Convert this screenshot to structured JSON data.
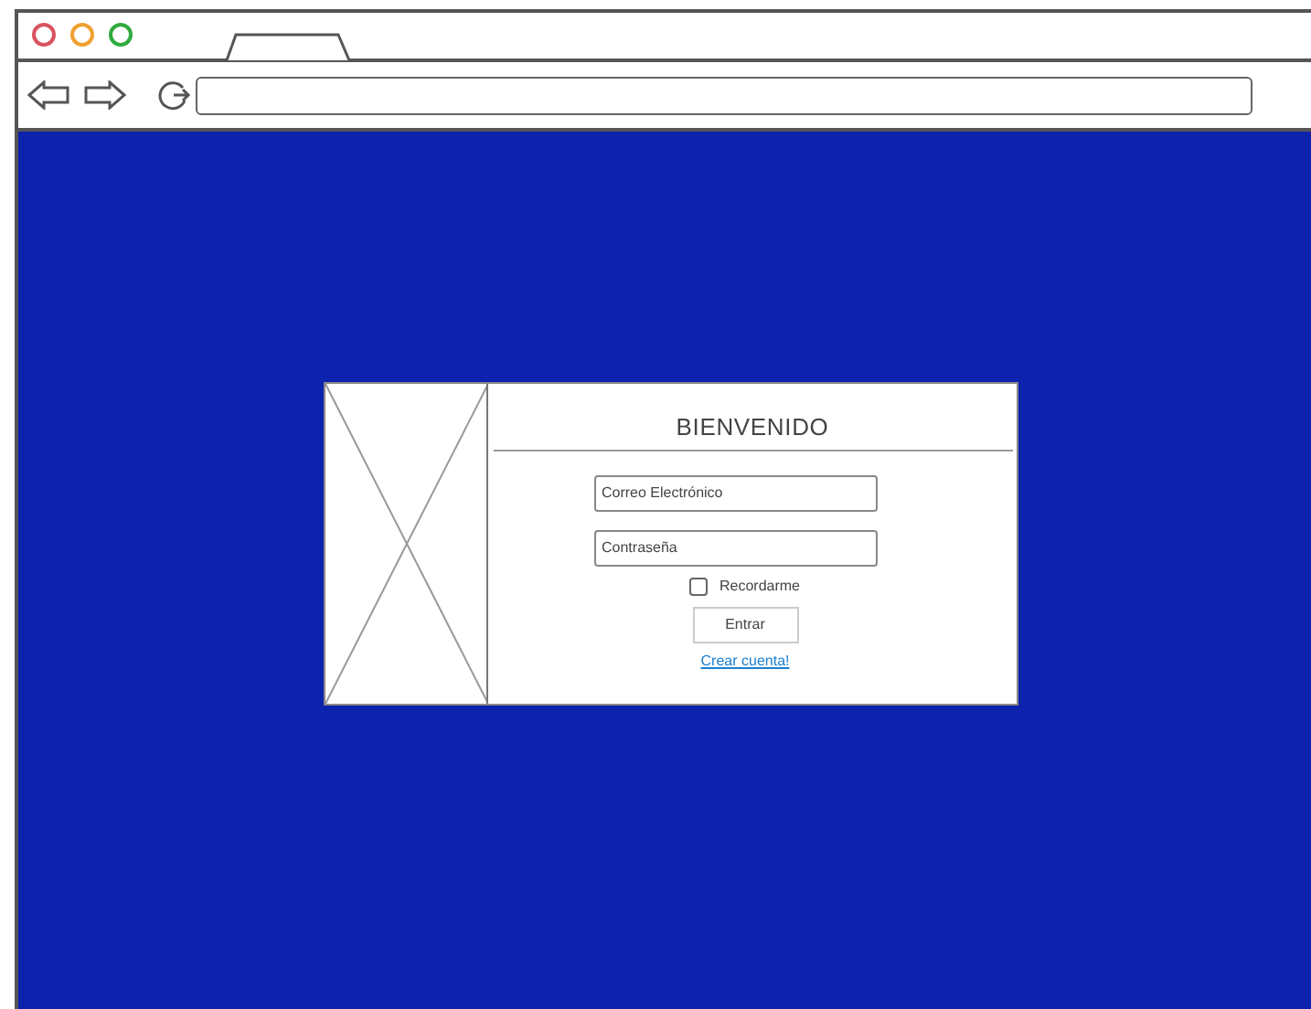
{
  "login": {
    "title": "BIENVENIDO",
    "fields": [
      {
        "placeholder": "Correo Electrónico"
      },
      {
        "placeholder": "Contraseña"
      }
    ],
    "remember": {
      "label": "Recordarme",
      "checked": false
    },
    "submit": "Entrar",
    "link": "Crear cuenta!"
  }
}
